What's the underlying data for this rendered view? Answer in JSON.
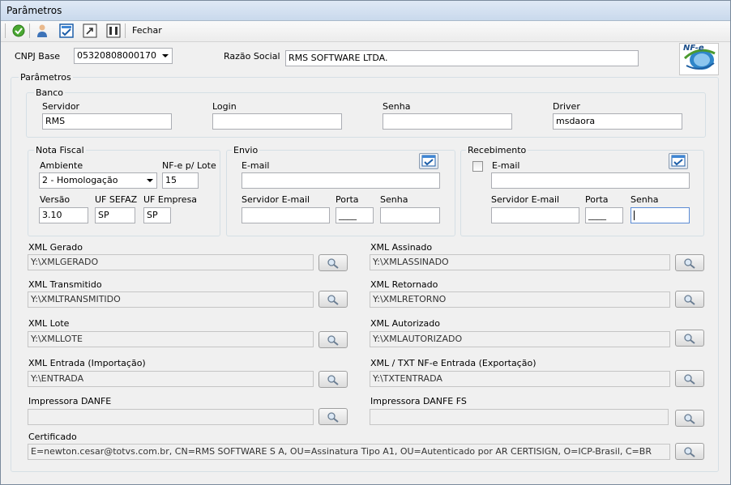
{
  "window": {
    "title": "Parâmetros"
  },
  "toolbar": {
    "close_label": "Fechar"
  },
  "header": {
    "cnpj_label": "CNPJ Base",
    "cnpj_value": "05320808000170",
    "razao_label": "Razão Social",
    "razao_value": "RMS SOFTWARE LTDA."
  },
  "logo": {
    "text": "NF-e"
  },
  "params": {
    "title": "Parâmetros"
  },
  "banco": {
    "title": "Banco",
    "servidor_label": "Servidor",
    "servidor_value": "RMS",
    "login_label": "Login",
    "login_value": "",
    "senha_label": "Senha",
    "senha_value": "",
    "driver_label": "Driver",
    "driver_value": "msdaora"
  },
  "nota_fiscal": {
    "title": "Nota Fiscal",
    "ambiente_label": "Ambiente",
    "ambiente_value": "2 - Homologação",
    "nfe_lote_label": "NF-e p/ Lote",
    "nfe_lote_value": "15",
    "versao_label": "Versão",
    "versao_value": "3.10",
    "uf_sefaz_label": "UF SEFAZ",
    "uf_sefaz_value": "SP",
    "uf_empresa_label": "UF Empresa",
    "uf_empresa_value": "SP"
  },
  "envio": {
    "title": "Envio",
    "email_label": "E-mail",
    "email_value": "",
    "servidor_label": "Servidor E-mail",
    "servidor_value": "",
    "porta_label": "Porta",
    "porta_value": "____",
    "senha_label": "Senha",
    "senha_value": ""
  },
  "recebimento": {
    "title": "Recebimento",
    "email_label": "E-mail",
    "email_value": "",
    "servidor_label": "Servidor E-mail",
    "servidor_value": "",
    "porta_label": "Porta",
    "porta_value": "____",
    "senha_label": "Senha",
    "senha_value": ""
  },
  "paths": {
    "gerado_label": "XML Gerado",
    "gerado_value": "Y:\\XMLGERADO",
    "assinado_label": "XML Assinado",
    "assinado_value": "Y:\\XMLASSINADO",
    "transmitido_label": "XML Transmitido",
    "transmitido_value": "Y:\\XMLTRANSMITIDO",
    "retornado_label": "XML Retornado",
    "retornado_value": "Y:\\XMLRETORNO",
    "lote_label": "XML Lote",
    "lote_value": "Y:\\XMLLOTE",
    "autorizado_label": "XML Autorizado",
    "autorizado_value": "Y:\\XMLAUTORIZADO",
    "entrada_label": "XML Entrada (Importação)",
    "entrada_value": "Y:\\ENTRADA",
    "txt_label": "XML / TXT NF-e Entrada (Exportação)",
    "txt_value": "Y:\\TXTENTRADA",
    "danfe_label": "Impressora DANFE",
    "danfe_value": "",
    "danfe_fs_label": "Impressora DANFE FS",
    "danfe_fs_value": "",
    "certificado_label": "Certificado",
    "certificado_value": "E=newton.cesar@totvs.com.br, CN=RMS SOFTWARE S A, OU=Assinatura Tipo A1, OU=Autenticado por AR CERTISIGN, O=ICP-Brasil, C=BR"
  },
  "icons": {
    "confirm": "check-circle-icon",
    "user": "user-icon",
    "checklist": "checklist-icon",
    "export": "export-icon",
    "columns": "columns-icon",
    "search": "magnifier-icon"
  }
}
